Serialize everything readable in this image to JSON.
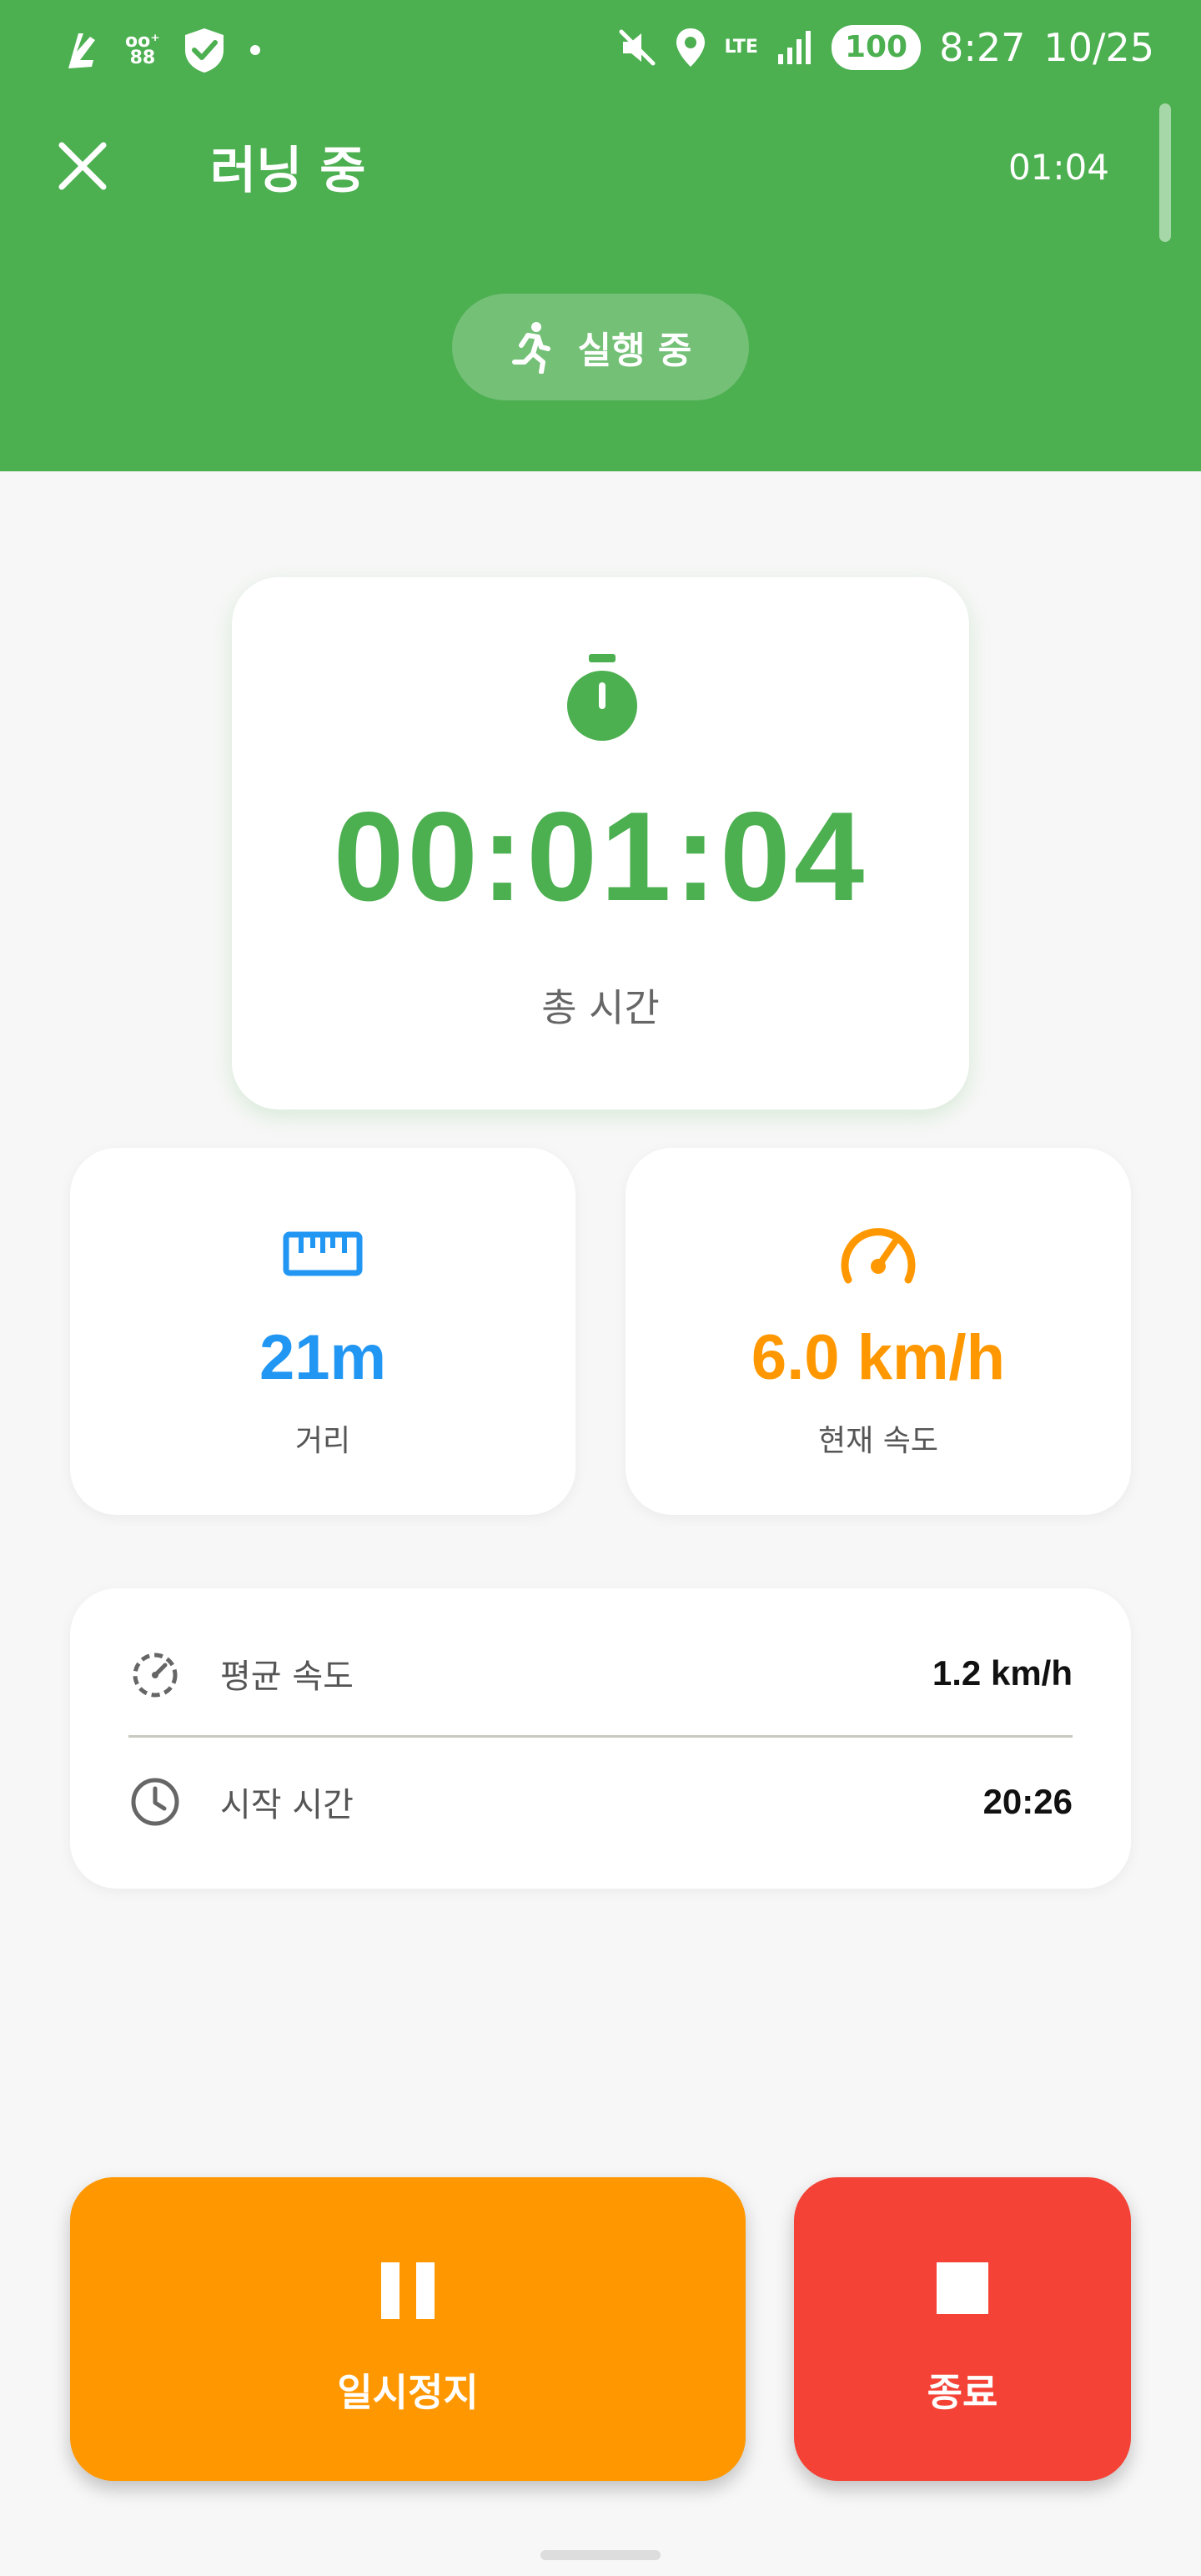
{
  "status_bar": {
    "time": "8:27",
    "date": "10/25",
    "battery": "100",
    "network": "LTE",
    "icons": [
      "app-icon",
      "app-icon",
      "shield-check-icon",
      "dot-icon",
      "mute-icon",
      "location-icon",
      "lte-icon",
      "signal-icon",
      "battery-icon"
    ]
  },
  "header": {
    "title": "러닝 중",
    "elapsed_small": "01:04",
    "status_pill": "실행 중",
    "close_icon": "close-icon",
    "background_color": "#4caf50"
  },
  "total_time": {
    "value": "00:01:04",
    "label": "총 시간",
    "icon": "stopwatch-icon",
    "color": "#4caf50"
  },
  "stats": {
    "distance": {
      "value": "21m",
      "label": "거리",
      "icon": "ruler-icon",
      "color": "#2196f3"
    },
    "current_speed": {
      "value": "6.0 km/h",
      "label": "현재 속도",
      "icon": "speedometer-icon",
      "color": "#ff9800"
    }
  },
  "info": {
    "avg_speed": {
      "label": "평균 속도",
      "value": "1.2 km/h",
      "icon": "timer-dashed-icon"
    },
    "start_time": {
      "label": "시작 시간",
      "value": "20:26",
      "icon": "clock-icon"
    }
  },
  "controls": {
    "pause": {
      "label": "일시정지",
      "icon": "pause-icon",
      "color": "#ff9800"
    },
    "stop": {
      "label": "종료",
      "icon": "stop-icon",
      "color": "#f44336"
    }
  }
}
